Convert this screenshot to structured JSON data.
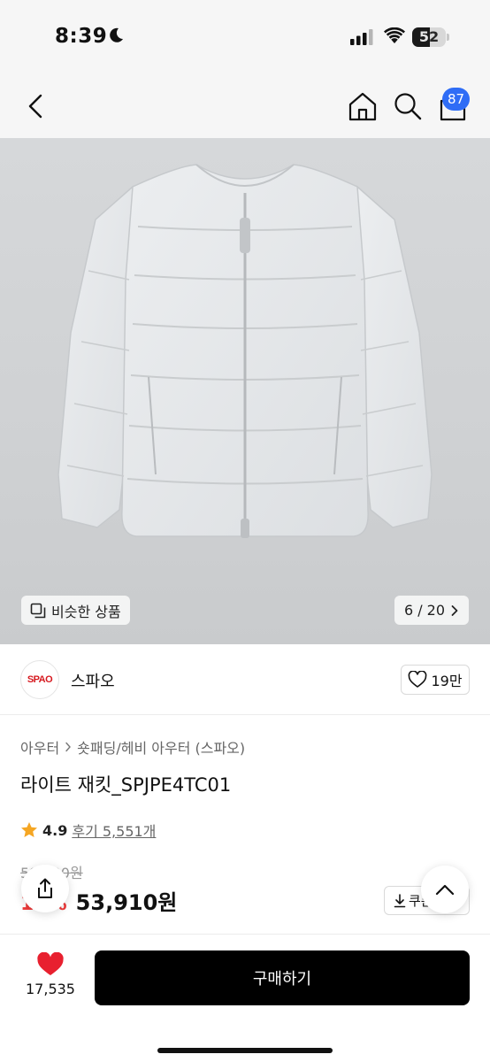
{
  "status_bar": {
    "time": "8:39",
    "battery": "52",
    "battery_level": 0.52
  },
  "header": {
    "cart_count": "87",
    "icons": [
      "back-arrow-icon",
      "home-icon",
      "search-icon",
      "cart-icon"
    ]
  },
  "gallery": {
    "similar_label": "비슷한 상품",
    "counter": "6 / 20"
  },
  "brand": {
    "logo_text": "SPAO",
    "name": "스파오",
    "likes": "19만"
  },
  "product": {
    "breadcrumb": [
      "아우터",
      "숏패딩/헤비 아우터 (스파오)"
    ],
    "title": "라이트 재킷_SPJPE4TC01",
    "rating": "4.9",
    "reviews": "후기 5,551개",
    "original_price": "59,900원",
    "discount": "10%",
    "price": "53,910원",
    "coupon_label": "쿠폰"
  },
  "bottom_bar": {
    "wish_count": "17,535",
    "buy_label": "구매하기"
  },
  "colors": {
    "accent_blue": "#2f6df6",
    "heart_red": "#e8202f",
    "discount_red": "#ef3b3b",
    "buy_button": "#000000"
  }
}
